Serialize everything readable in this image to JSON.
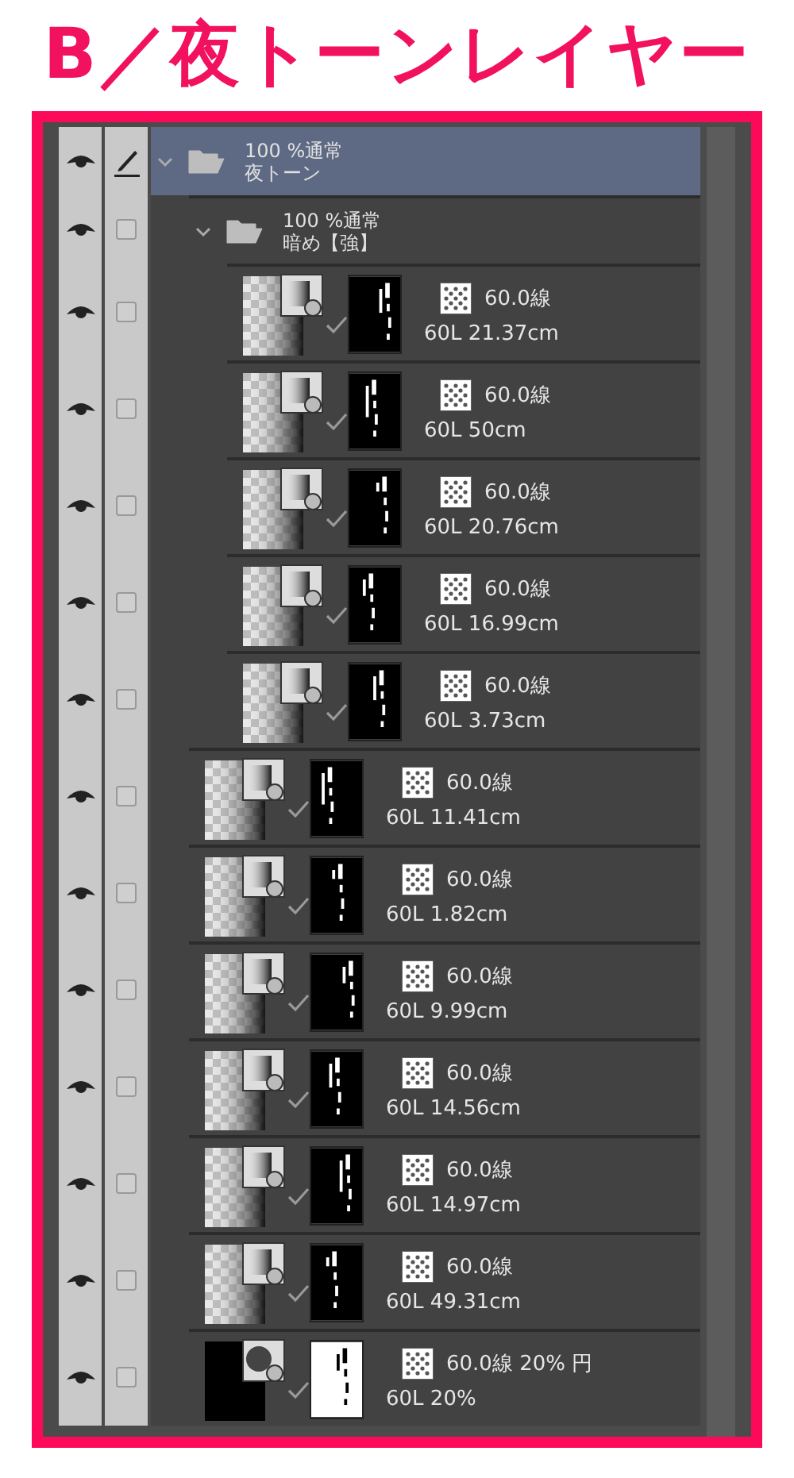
{
  "heading": "B／夜トーンレイヤー",
  "layers": [
    {
      "kind": "folder",
      "opacity": "100 %通常",
      "name": "夜トーン",
      "visible": true,
      "editing": true,
      "expanded": true,
      "selected": true,
      "children": [
        {
          "kind": "folder",
          "opacity": "100 %通常",
          "name": "暗め【強】",
          "visible": true,
          "editing": false,
          "expanded": true,
          "selected": false,
          "children": [
            {
              "kind": "tone",
              "tone": "60.0線",
              "name": "60L 21.37cm",
              "visible": true,
              "editing": false,
              "selected": false
            },
            {
              "kind": "tone",
              "tone": "60.0線",
              "name": "60L 50cm",
              "visible": true,
              "editing": false,
              "selected": false
            },
            {
              "kind": "tone",
              "tone": "60.0線",
              "name": "60L 20.76cm",
              "visible": true,
              "editing": false,
              "selected": false
            },
            {
              "kind": "tone",
              "tone": "60.0線",
              "name": "60L 16.99cm",
              "visible": true,
              "editing": false,
              "selected": false
            },
            {
              "kind": "tone",
              "tone": "60.0線",
              "name": "60L 3.73cm",
              "visible": true,
              "editing": false,
              "selected": false
            }
          ]
        },
        {
          "kind": "tone",
          "tone": "60.0線",
          "name": "60L 11.41cm",
          "visible": true,
          "editing": false,
          "selected": false
        },
        {
          "kind": "tone",
          "tone": "60.0線",
          "name": "60L 1.82cm",
          "visible": true,
          "editing": false,
          "selected": false
        },
        {
          "kind": "tone",
          "tone": "60.0線",
          "name": "60L 9.99cm",
          "visible": true,
          "editing": false,
          "selected": false
        },
        {
          "kind": "tone",
          "tone": "60.0線",
          "name": "60L 14.56cm",
          "visible": true,
          "editing": false,
          "selected": false
        },
        {
          "kind": "tone",
          "tone": "60.0線",
          "name": "60L 14.97cm",
          "visible": true,
          "editing": false,
          "selected": false
        },
        {
          "kind": "tone",
          "tone": "60.0線",
          "name": "60L 49.31cm",
          "visible": true,
          "editing": false,
          "selected": false
        },
        {
          "kind": "tone_fill",
          "tone": "60.0線 20% 円",
          "name": "60L 20%",
          "visible": true,
          "editing": false,
          "selected": false
        }
      ]
    }
  ]
}
